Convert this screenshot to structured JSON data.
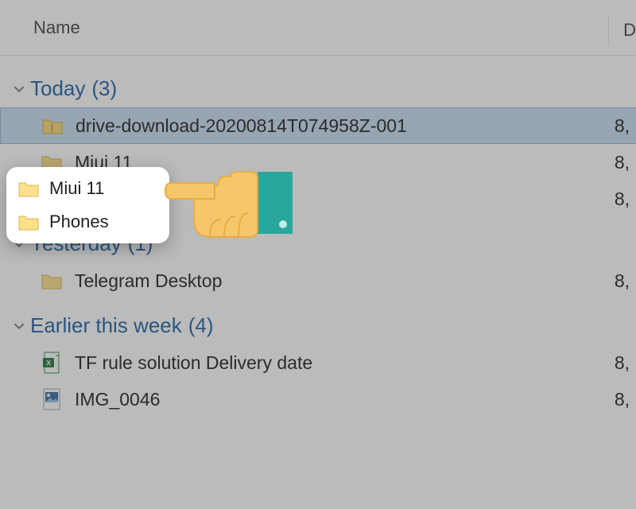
{
  "header": {
    "name_col": "Name",
    "date_col": "D"
  },
  "groups": {
    "today": {
      "label": "Today",
      "count": "(3)",
      "items": [
        {
          "name": "drive-download-20200814T074958Z-001",
          "date": "8,",
          "selected": true,
          "icon": "folder-zip"
        },
        {
          "name": "Miui 11",
          "date": "8,",
          "icon": "folder"
        },
        {
          "name": "Phones",
          "date": "8,",
          "icon": "folder"
        }
      ]
    },
    "yesterday": {
      "label": "Yesterday",
      "count": "(1)",
      "items": [
        {
          "name": "Telegram Desktop",
          "date": "8,",
          "icon": "folder"
        }
      ]
    },
    "earlier": {
      "label": "Earlier this week",
      "count": "(4)",
      "items": [
        {
          "name": "TF rule solution Delivery date",
          "date": "8,",
          "icon": "excel"
        },
        {
          "name": "IMG_0046",
          "date": "8,",
          "icon": "image"
        }
      ]
    }
  },
  "popout": {
    "items": [
      {
        "name": "Miui 11"
      },
      {
        "name": "Phones"
      }
    ]
  }
}
